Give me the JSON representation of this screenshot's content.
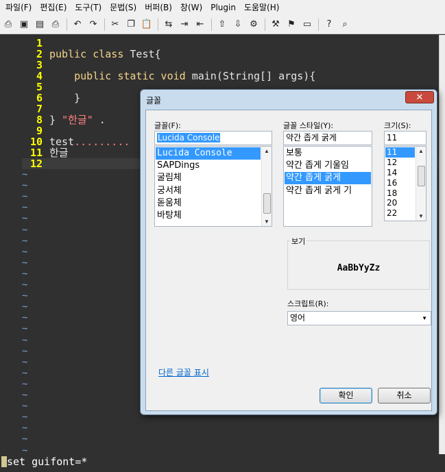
{
  "menu": [
    "파일(F)",
    "편집(E)",
    "도구(T)",
    "문법(S)",
    "버퍼(B)",
    "창(W)",
    "Plugin",
    "도움말(H)"
  ],
  "toolbar": {
    "icons": [
      "open-icon",
      "save-icon",
      "save-all-icon",
      "print-icon",
      "sep",
      "undo-icon",
      "redo-icon",
      "sep",
      "cut-icon",
      "copy-icon",
      "paste-icon",
      "sep",
      "replace-icon",
      "find-next-icon",
      "find-prev-icon",
      "sep",
      "load-session-icon",
      "save-session-icon",
      "run-script-icon",
      "sep",
      "make-icon",
      "build-tags-icon",
      "jump-tag-icon",
      "sep",
      "help-icon",
      "find-help-icon"
    ],
    "glyphs": {
      "open-icon": "⎙",
      "save-icon": "▣",
      "save-all-icon": "▤",
      "print-icon": "⎙",
      "undo-icon": "↶",
      "redo-icon": "↷",
      "cut-icon": "✂",
      "copy-icon": "❐",
      "paste-icon": "📋",
      "replace-icon": "⇆",
      "find-next-icon": "⇥",
      "find-prev-icon": "⇤",
      "load-session-icon": "⇧",
      "save-session-icon": "⇩",
      "run-script-icon": "⚙",
      "make-icon": "⚒",
      "build-tags-icon": "⚑",
      "jump-tag-icon": "▭",
      "help-icon": "?",
      "find-help-icon": "⌕"
    }
  },
  "editor": {
    "lines": [
      {
        "num": "1",
        "segments": []
      },
      {
        "num": "2",
        "segments": [
          {
            "t": "public class ",
            "c": "kw"
          },
          {
            "t": "Test{",
            "c": ""
          }
        ]
      },
      {
        "num": "3",
        "segments": []
      },
      {
        "num": "4",
        "segments": [
          {
            "t": "    public static void ",
            "c": "kw"
          },
          {
            "t": "main(String[] args){",
            "c": ""
          }
        ]
      },
      {
        "num": "5",
        "segments": []
      },
      {
        "num": "6",
        "segments": [
          {
            "t": "    }",
            "c": ""
          }
        ]
      },
      {
        "num": "7",
        "segments": []
      },
      {
        "num": "8",
        "segments": [
          {
            "t": "} ",
            "c": ""
          },
          {
            "t": "\"한글\"",
            "c": "str"
          },
          {
            "t": " .",
            "c": ""
          }
        ]
      },
      {
        "num": "9",
        "segments": []
      },
      {
        "num": "10",
        "segments": [
          {
            "t": "test",
            "c": ""
          },
          {
            "t": ".........",
            "c": "str"
          }
        ]
      },
      {
        "num": "11",
        "segments": [
          {
            "t": "한글",
            "c": ""
          }
        ]
      },
      {
        "num": "12",
        "segments": []
      }
    ],
    "tilde": "~",
    "tilde_count": 26
  },
  "command_line": "set guifont=*",
  "dialog": {
    "title": "글꼴",
    "close_label": "✕",
    "font_label": "글꼴(F):",
    "font_value": "Lucida Console",
    "font_list": [
      "Lucida Console",
      "SAPDings",
      "굴림체",
      "궁서체",
      "돋움체",
      "바탕체"
    ],
    "font_selected_index": 0,
    "style_label": "글꼴 스타일(Y):",
    "style_value": "약간 좁게 굵게",
    "style_list": [
      "보통",
      "약간 좁게 기울임",
      "약간 좁게 굵게",
      "약간 좁게 굵게 기"
    ],
    "style_selected_index": 2,
    "size_label": "크기(S):",
    "size_value": "11",
    "size_list": [
      "11",
      "12",
      "14",
      "16",
      "18",
      "20",
      "22"
    ],
    "size_selected_index": 0,
    "preview_label": "보기",
    "preview_text": "AaBbYyZz",
    "script_label": "스크립트(R):",
    "script_value": "영어",
    "more_fonts_link": "다른 글꼴 표시",
    "ok_label": "확인",
    "cancel_label": "취소"
  }
}
